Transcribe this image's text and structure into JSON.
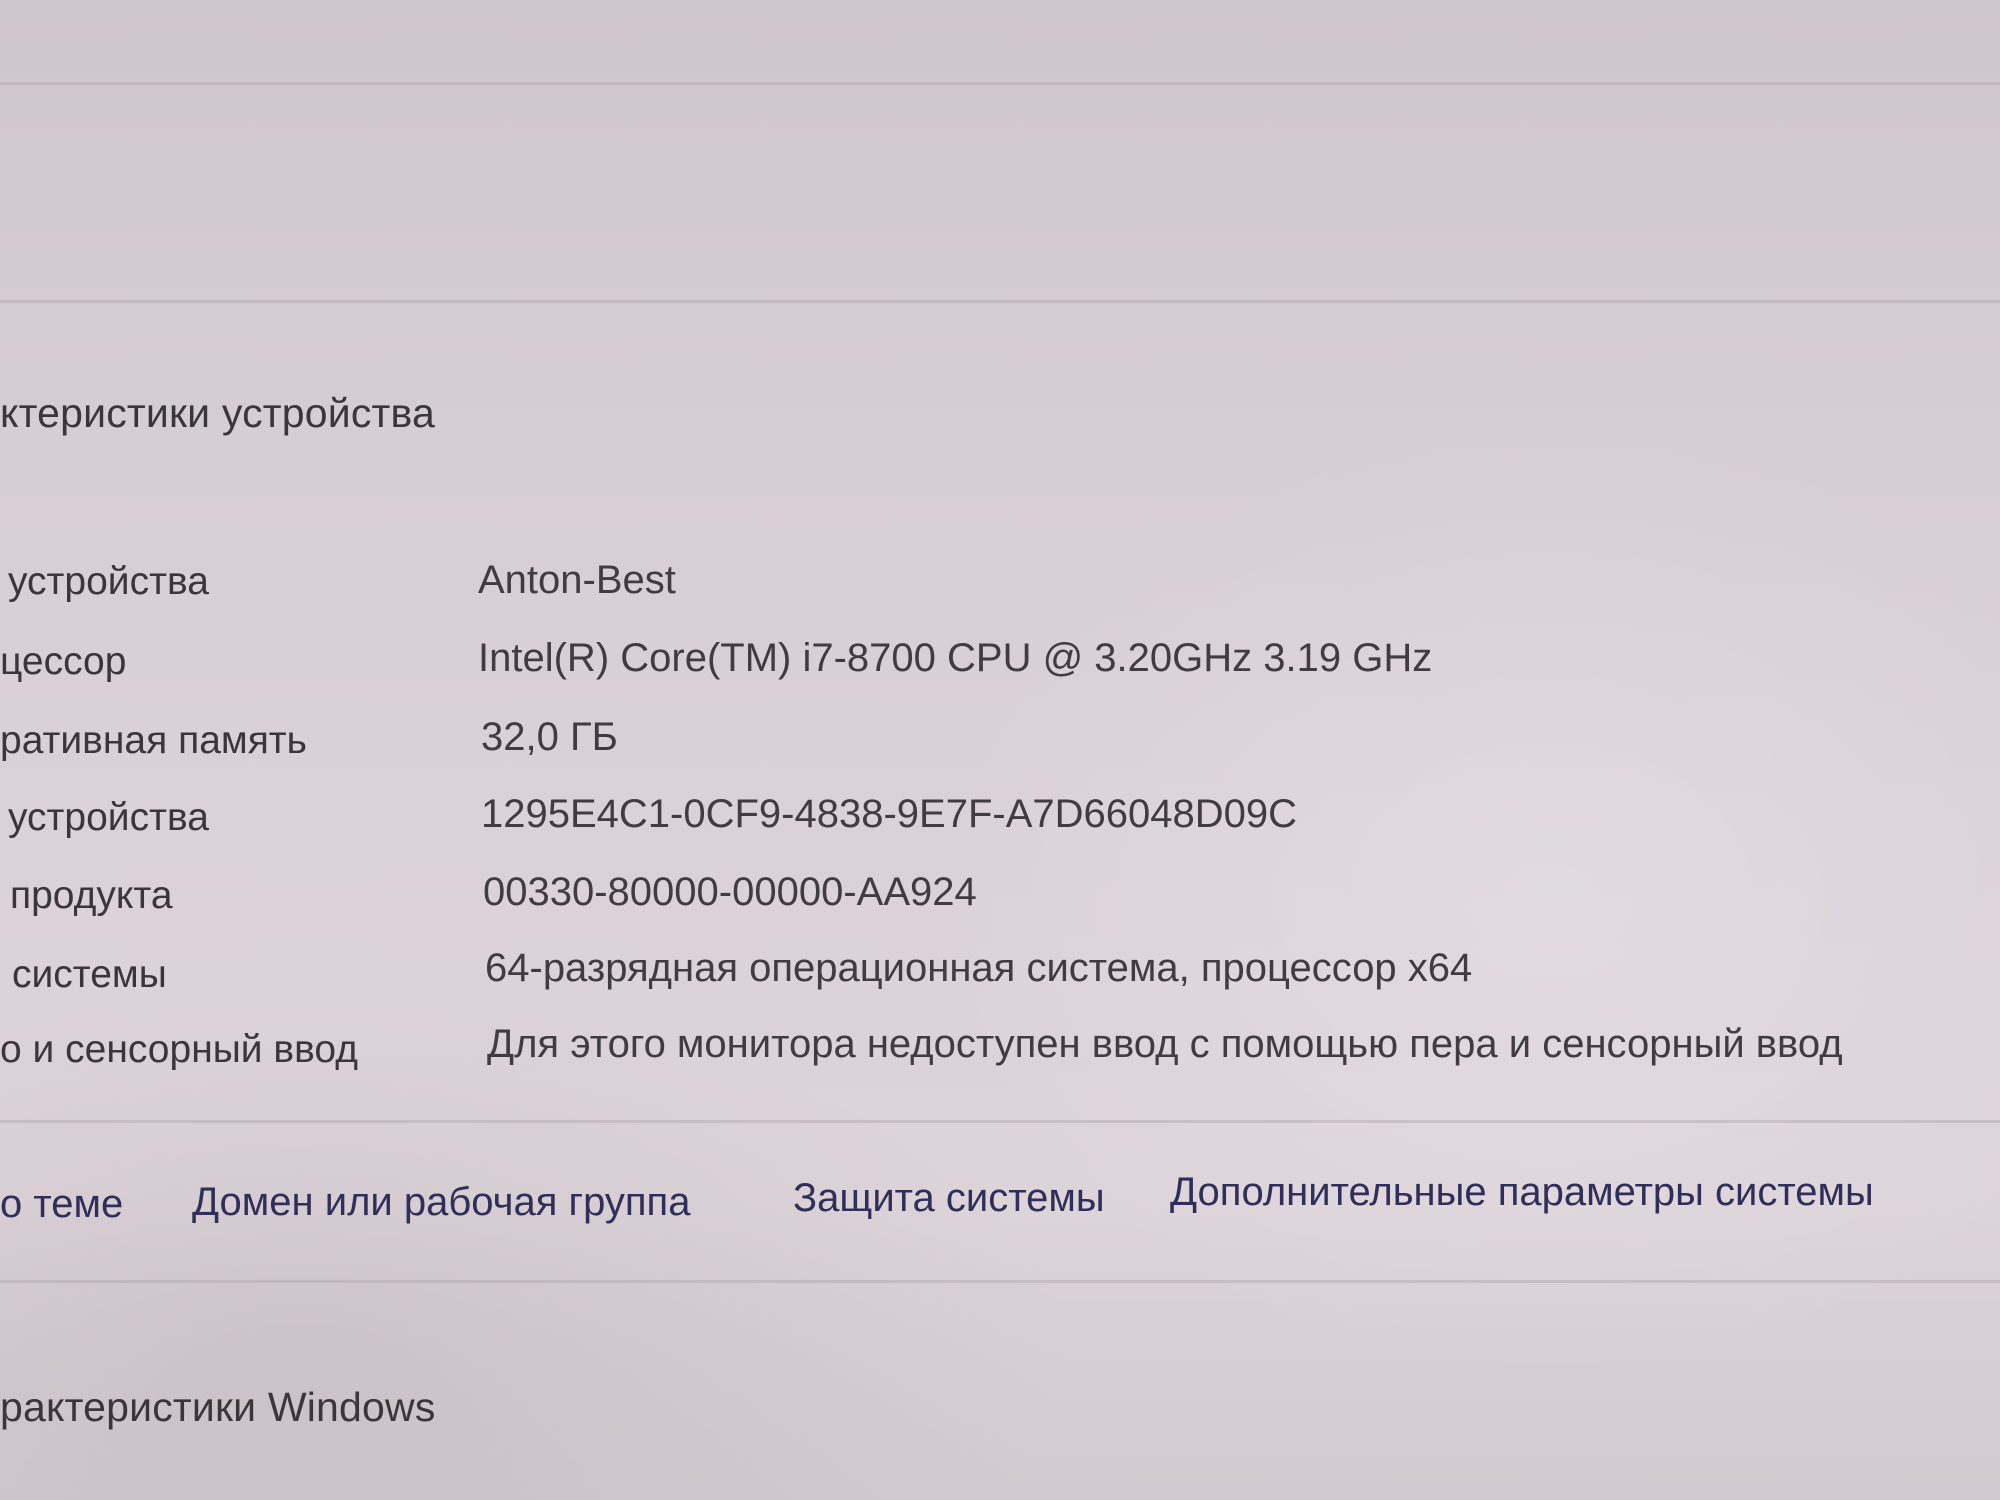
{
  "device_specs": {
    "title": "ктеристики устройства",
    "rows": [
      {
        "label": "устройства",
        "value": "Anton-Best"
      },
      {
        "label": "цессор",
        "value": "Intel(R) Core(TM) i7-8700 CPU @ 3.20GHz   3.19 GHz"
      },
      {
        "label": "ративная память",
        "value": "32,0 ГБ"
      },
      {
        "label": "устройства",
        "value": "1295E4C1-0CF9-4838-9E7F-A7D66048D09C"
      },
      {
        "label": "продукта",
        "value": "00330-80000-00000-AA924"
      },
      {
        "label": "системы",
        "value": "64-разрядная операционная система, процессор x64"
      },
      {
        "label": "о и сенсорный ввод",
        "value": "Для этого монитора недоступен ввод с помощью пера и сенсорный ввод"
      }
    ]
  },
  "related_links": [
    {
      "label": "о теме"
    },
    {
      "label": "Домен или рабочая группа"
    },
    {
      "label": "Защита системы"
    },
    {
      "label": "Дополнительные параметры системы"
    }
  ],
  "windows_specs": {
    "title": "рактеристики Windows"
  }
}
